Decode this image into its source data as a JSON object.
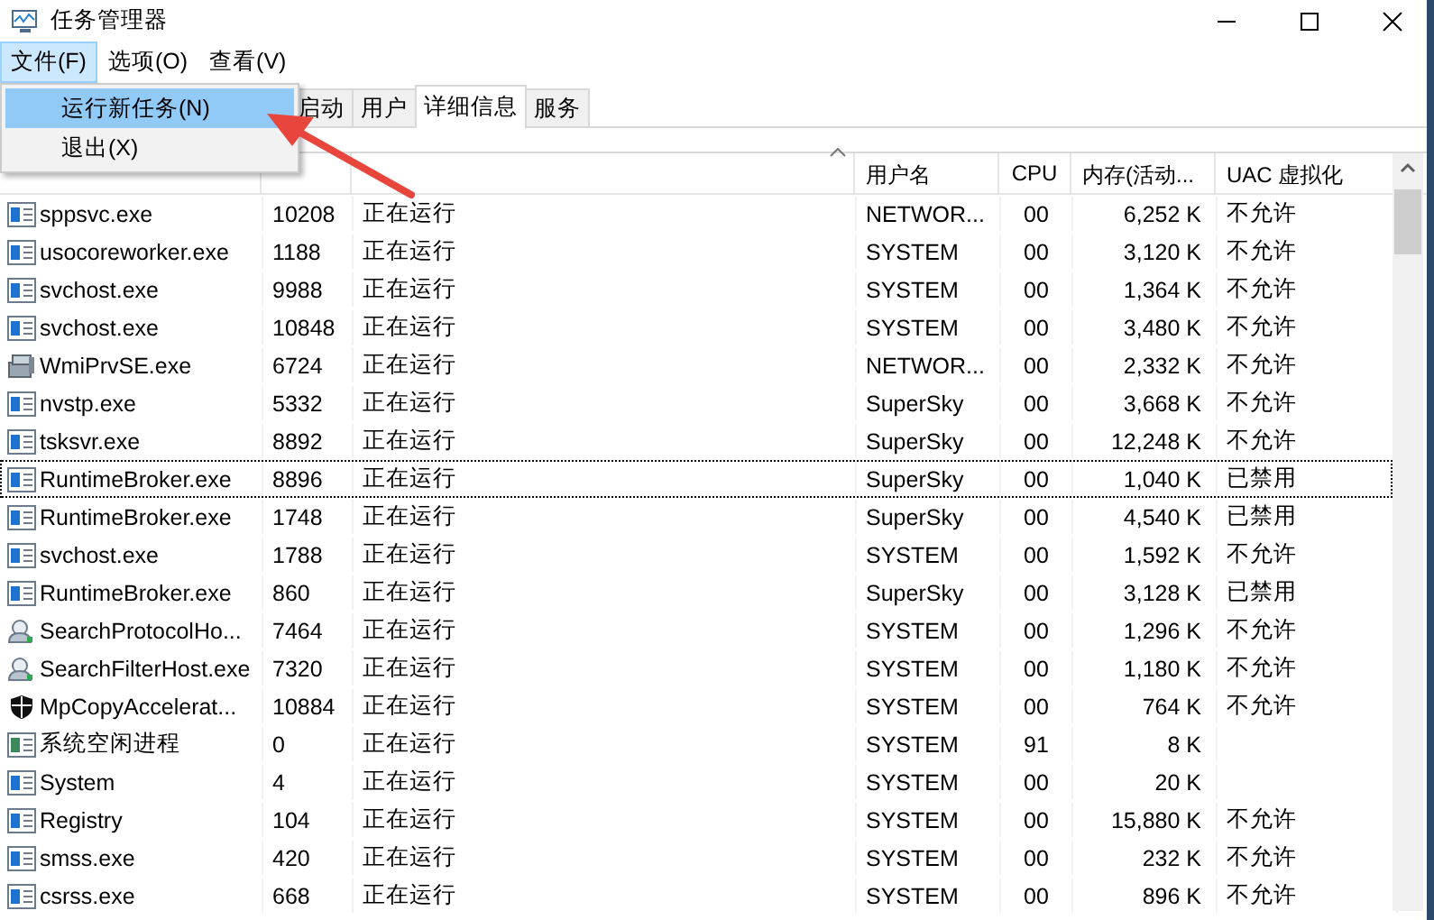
{
  "window": {
    "title": "任务管理器"
  },
  "menu_bar": [
    {
      "label": "文件(F)",
      "open": true
    },
    {
      "label": "选项(O)",
      "open": false
    },
    {
      "label": "查看(V)",
      "open": false
    }
  ],
  "file_menu": [
    {
      "label": "运行新任务(N)",
      "selected": true
    },
    {
      "label": "退出(X)",
      "selected": false
    }
  ],
  "tabs": [
    {
      "label": "启动",
      "selected": false
    },
    {
      "label": "用户",
      "selected": false
    },
    {
      "label": "详细信息",
      "selected": true
    },
    {
      "label": "服务",
      "selected": false
    }
  ],
  "table": {
    "columns": [
      {},
      {},
      {
        "sorted": true
      },
      {
        "label": "用户名",
        "sorted": false
      },
      {
        "label": "CPU",
        "sorted": false
      },
      {
        "label": "内存(活动...",
        "sorted": false
      },
      {
        "label": "UAC 虚拟化",
        "sorted": false
      }
    ],
    "rows": [
      {
        "kind": "app",
        "name": "sppsvc.exe",
        "pid": "10208",
        "status": "正在运行",
        "user": "NETWOR...",
        "cpu": "00",
        "memory": "6,252 K",
        "uac": "不允许",
        "focused": false
      },
      {
        "kind": "app",
        "name": "usocoreworker.exe",
        "pid": "1188",
        "status": "正在运行",
        "user": "SYSTEM",
        "cpu": "00",
        "memory": "3,120 K",
        "uac": "不允许",
        "focused": false
      },
      {
        "kind": "app",
        "name": "svchost.exe",
        "pid": "9988",
        "status": "正在运行",
        "user": "SYSTEM",
        "cpu": "00",
        "memory": "1,364 K",
        "uac": "不允许",
        "focused": false
      },
      {
        "kind": "app",
        "name": "svchost.exe",
        "pid": "10848",
        "status": "正在运行",
        "user": "SYSTEM",
        "cpu": "00",
        "memory": "3,480 K",
        "uac": "不允许",
        "focused": false
      },
      {
        "kind": "service",
        "name": "WmiPrvSE.exe",
        "pid": "6724",
        "status": "正在运行",
        "user": "NETWOR...",
        "cpu": "00",
        "memory": "2,332 K",
        "uac": "不允许",
        "focused": false
      },
      {
        "kind": "app",
        "name": "nvstp.exe",
        "pid": "5332",
        "status": "正在运行",
        "user": "SuperSky",
        "cpu": "00",
        "memory": "3,668 K",
        "uac": "不允许",
        "focused": false
      },
      {
        "kind": "app",
        "name": "tsksvr.exe",
        "pid": "8892",
        "status": "正在运行",
        "user": "SuperSky",
        "cpu": "00",
        "memory": "12,248 K",
        "uac": "不允许",
        "focused": false
      },
      {
        "kind": "app",
        "name": "RuntimeBroker.exe",
        "pid": "8896",
        "status": "正在运行",
        "user": "SuperSky",
        "cpu": "00",
        "memory": "1,040 K",
        "uac": "已禁用",
        "focused": true
      },
      {
        "kind": "app",
        "name": "RuntimeBroker.exe",
        "pid": "1748",
        "status": "正在运行",
        "user": "SuperSky",
        "cpu": "00",
        "memory": "4,540 K",
        "uac": "已禁用",
        "focused": false
      },
      {
        "kind": "app",
        "name": "svchost.exe",
        "pid": "1788",
        "status": "正在运行",
        "user": "SYSTEM",
        "cpu": "00",
        "memory": "1,592 K",
        "uac": "不允许",
        "focused": false
      },
      {
        "kind": "app",
        "name": "RuntimeBroker.exe",
        "pid": "860",
        "status": "正在运行",
        "user": "SuperSky",
        "cpu": "00",
        "memory": "3,128 K",
        "uac": "已禁用",
        "focused": false
      },
      {
        "kind": "search",
        "name": "SearchProtocolHo...",
        "pid": "7464",
        "status": "正在运行",
        "user": "SYSTEM",
        "cpu": "00",
        "memory": "1,296 K",
        "uac": "不允许",
        "focused": false
      },
      {
        "kind": "search",
        "name": "SearchFilterHost.exe",
        "pid": "7320",
        "status": "正在运行",
        "user": "SYSTEM",
        "cpu": "00",
        "memory": "1,180 K",
        "uac": "不允许",
        "focused": false
      },
      {
        "kind": "shield",
        "name": "MpCopyAccelerat...",
        "pid": "10884",
        "status": "正在运行",
        "user": "SYSTEM",
        "cpu": "00",
        "memory": "764 K",
        "uac": "不允许",
        "focused": false
      },
      {
        "kind": "idle",
        "name": "系统空闲进程",
        "pid": "0",
        "status": "正在运行",
        "user": "SYSTEM",
        "cpu": "91",
        "memory": "8 K",
        "focused": false
      },
      {
        "kind": "app",
        "name": "System",
        "pid": "4",
        "status": "正在运行",
        "user": "SYSTEM",
        "cpu": "00",
        "memory": "20 K",
        "focused": false
      },
      {
        "kind": "app",
        "name": "Registry",
        "pid": "104",
        "status": "正在运行",
        "user": "SYSTEM",
        "cpu": "00",
        "memory": "15,880 K",
        "uac": "不允许",
        "focused": false
      },
      {
        "kind": "app",
        "name": "smss.exe",
        "pid": "420",
        "status": "正在运行",
        "user": "SYSTEM",
        "cpu": "00",
        "memory": "232 K",
        "uac": "不允许",
        "focused": false
      },
      {
        "kind": "app",
        "name": "csrss.exe",
        "pid": "668",
        "status": "正在运行",
        "user": "SYSTEM",
        "cpu": "00",
        "memory": "896 K",
        "uac": "不允许",
        "focused": false
      }
    ]
  }
}
